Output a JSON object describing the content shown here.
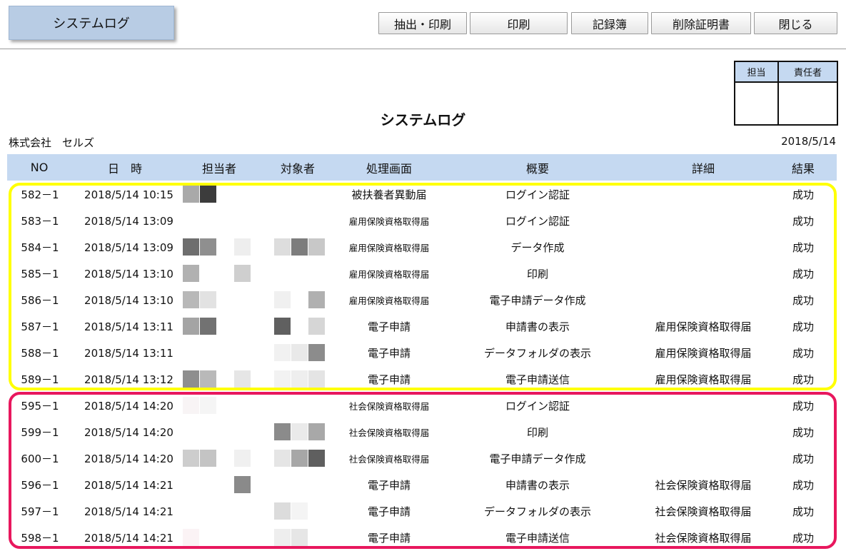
{
  "header": {
    "title_badge": "システムログ",
    "buttons": [
      {
        "label": "抽出・印刷"
      },
      {
        "label": "印刷"
      },
      {
        "label": "記録簿"
      },
      {
        "label": "削除証明書"
      },
      {
        "label": "閉じる"
      }
    ]
  },
  "approval": {
    "col1": "担当",
    "col2": "責任者"
  },
  "report": {
    "title": "システムログ",
    "company": "株式会社　セルズ",
    "date": "2018/5/14"
  },
  "table": {
    "columns": [
      "NO",
      "日　時",
      "担当者",
      "対象者",
      "処理画面",
      "概要",
      "詳細",
      "結果"
    ],
    "rows": [
      {
        "no": "582－1",
        "datetime": "2018/5/14 10:15",
        "screen": "被扶養者異動届",
        "summary": "ログイン認証",
        "detail": "",
        "result": "成功"
      },
      {
        "no": "583－1",
        "datetime": "2018/5/14 13:09",
        "screen": "雇用保険資格取得届",
        "summary": "ログイン認証",
        "detail": "",
        "result": "成功"
      },
      {
        "no": "584－1",
        "datetime": "2018/5/14 13:09",
        "screen": "雇用保険資格取得届",
        "summary": "データ作成",
        "detail": "",
        "result": "成功"
      },
      {
        "no": "585－1",
        "datetime": "2018/5/14 13:10",
        "screen": "雇用保険資格取得届",
        "summary": "印刷",
        "detail": "",
        "result": "成功"
      },
      {
        "no": "586－1",
        "datetime": "2018/5/14 13:10",
        "screen": "雇用保険資格取得届",
        "summary": "電子申請データ作成",
        "detail": "",
        "result": "成功"
      },
      {
        "no": "587－1",
        "datetime": "2018/5/14 13:11",
        "screen": "電子申請",
        "summary": "申請書の表示",
        "detail": "雇用保険資格取得届",
        "result": "成功"
      },
      {
        "no": "588－1",
        "datetime": "2018/5/14 13:11",
        "screen": "電子申請",
        "summary": "データフォルダの表示",
        "detail": "雇用保険資格取得届",
        "result": "成功"
      },
      {
        "no": "589－1",
        "datetime": "2018/5/14 13:12",
        "screen": "電子申請",
        "summary": "電子申請送信",
        "detail": "雇用保険資格取得届",
        "result": "成功"
      },
      {
        "no": "595－1",
        "datetime": "2018/5/14 14:20",
        "screen": "社会保険資格取得届",
        "summary": "ログイン認証",
        "detail": "",
        "result": "成功"
      },
      {
        "no": "599－1",
        "datetime": "2018/5/14 14:20",
        "screen": "社会保険資格取得届",
        "summary": "印刷",
        "detail": "",
        "result": "成功"
      },
      {
        "no": "600－1",
        "datetime": "2018/5/14 14:20",
        "screen": "社会保険資格取得届",
        "summary": "電子申請データ作成",
        "detail": "",
        "result": "成功"
      },
      {
        "no": "596－1",
        "datetime": "2018/5/14 14:21",
        "screen": "電子申請",
        "summary": "申請書の表示",
        "detail": "社会保険資格取得届",
        "result": "成功"
      },
      {
        "no": "597－1",
        "datetime": "2018/5/14 14:21",
        "screen": "電子申請",
        "summary": "データフォルダの表示",
        "detail": "社会保険資格取得届",
        "result": "成功"
      },
      {
        "no": "598－1",
        "datetime": "2018/5/14 14:21",
        "screen": "電子申請",
        "summary": "電子申請送信",
        "detail": "社会保険資格取得届",
        "result": "成功"
      }
    ]
  },
  "colors": {
    "header_fill": "#c5d9f1",
    "badge_fill": "#b8cce4",
    "highlight_yellow": "#ffff00",
    "highlight_red": "#e8175d"
  }
}
